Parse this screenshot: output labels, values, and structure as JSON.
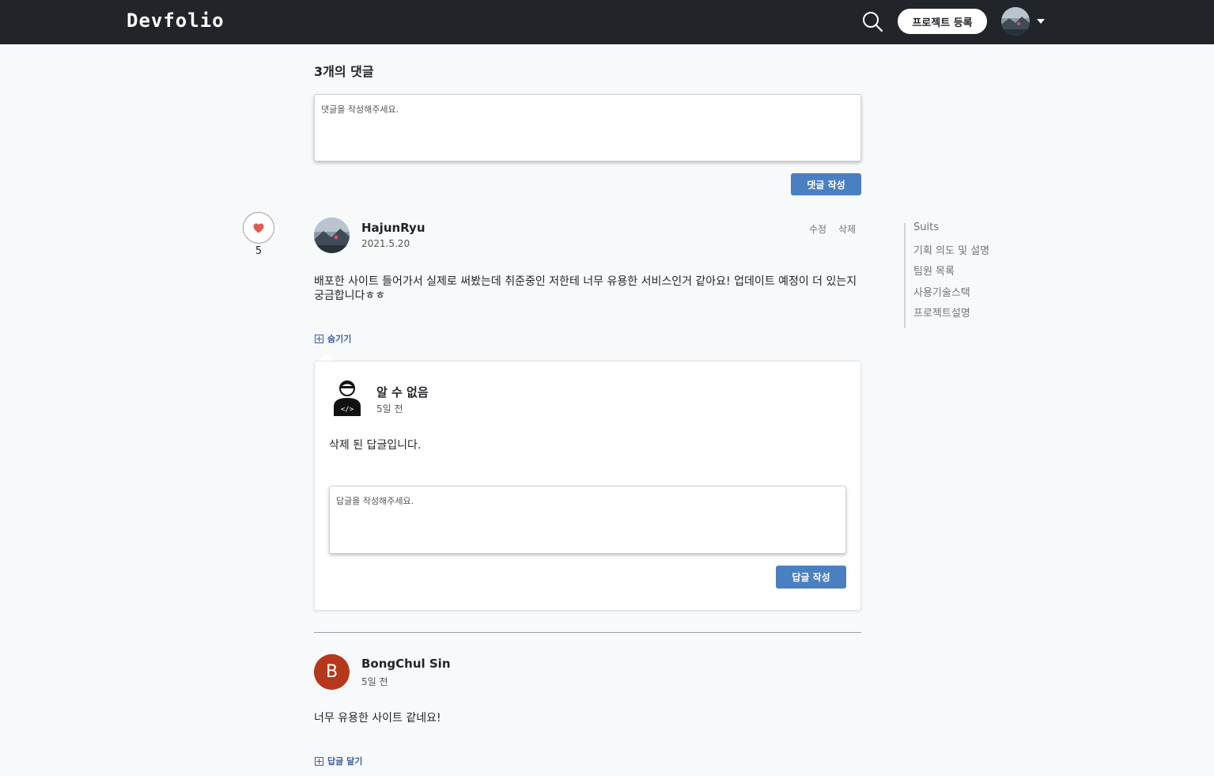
{
  "navbar": {
    "logo": "Devfolio",
    "register_label": "프로젝트 등록"
  },
  "comments": {
    "title": "3개의 댓글",
    "placeholder": "댓글을 작성해주세요.",
    "submit_label": "댓글 작성"
  },
  "like": {
    "count": "5"
  },
  "comment1": {
    "author": "HajunRyu",
    "date": "2021.5.20",
    "edit_label": "수정",
    "delete_label": "삭제",
    "body": "배포한 사이트 들어가서 실제로 써봤는데 취준중인 저한테 너무 유용한 서비스인거 같아요! 업데이트 예정이 더 있는지 궁금합니다ㅎㅎ",
    "toggle_label": "숨기기",
    "reply": {
      "author": "알 수 없음",
      "date": "5일 전",
      "body": "삭제 된 답글입니다.",
      "placeholder": "답글을 작성해주세요.",
      "submit_label": "답글 작성"
    }
  },
  "comment2": {
    "avatar_letter": "B",
    "author": "BongChul Sin",
    "date": "5일 전",
    "body": "너무 유용한 사이트 같네요!",
    "reply_label": "답글 달기"
  },
  "toc": {
    "items": [
      "Suits",
      "기획 의도 및 설명",
      "팀원 목록",
      "사용기술스택",
      "프로젝트설명"
    ]
  },
  "colors": {
    "navbar": "#212529",
    "primary_button": "#4a7fc1",
    "heart": "#e05a4f",
    "avatar_letter_bg": "#b5371c"
  }
}
